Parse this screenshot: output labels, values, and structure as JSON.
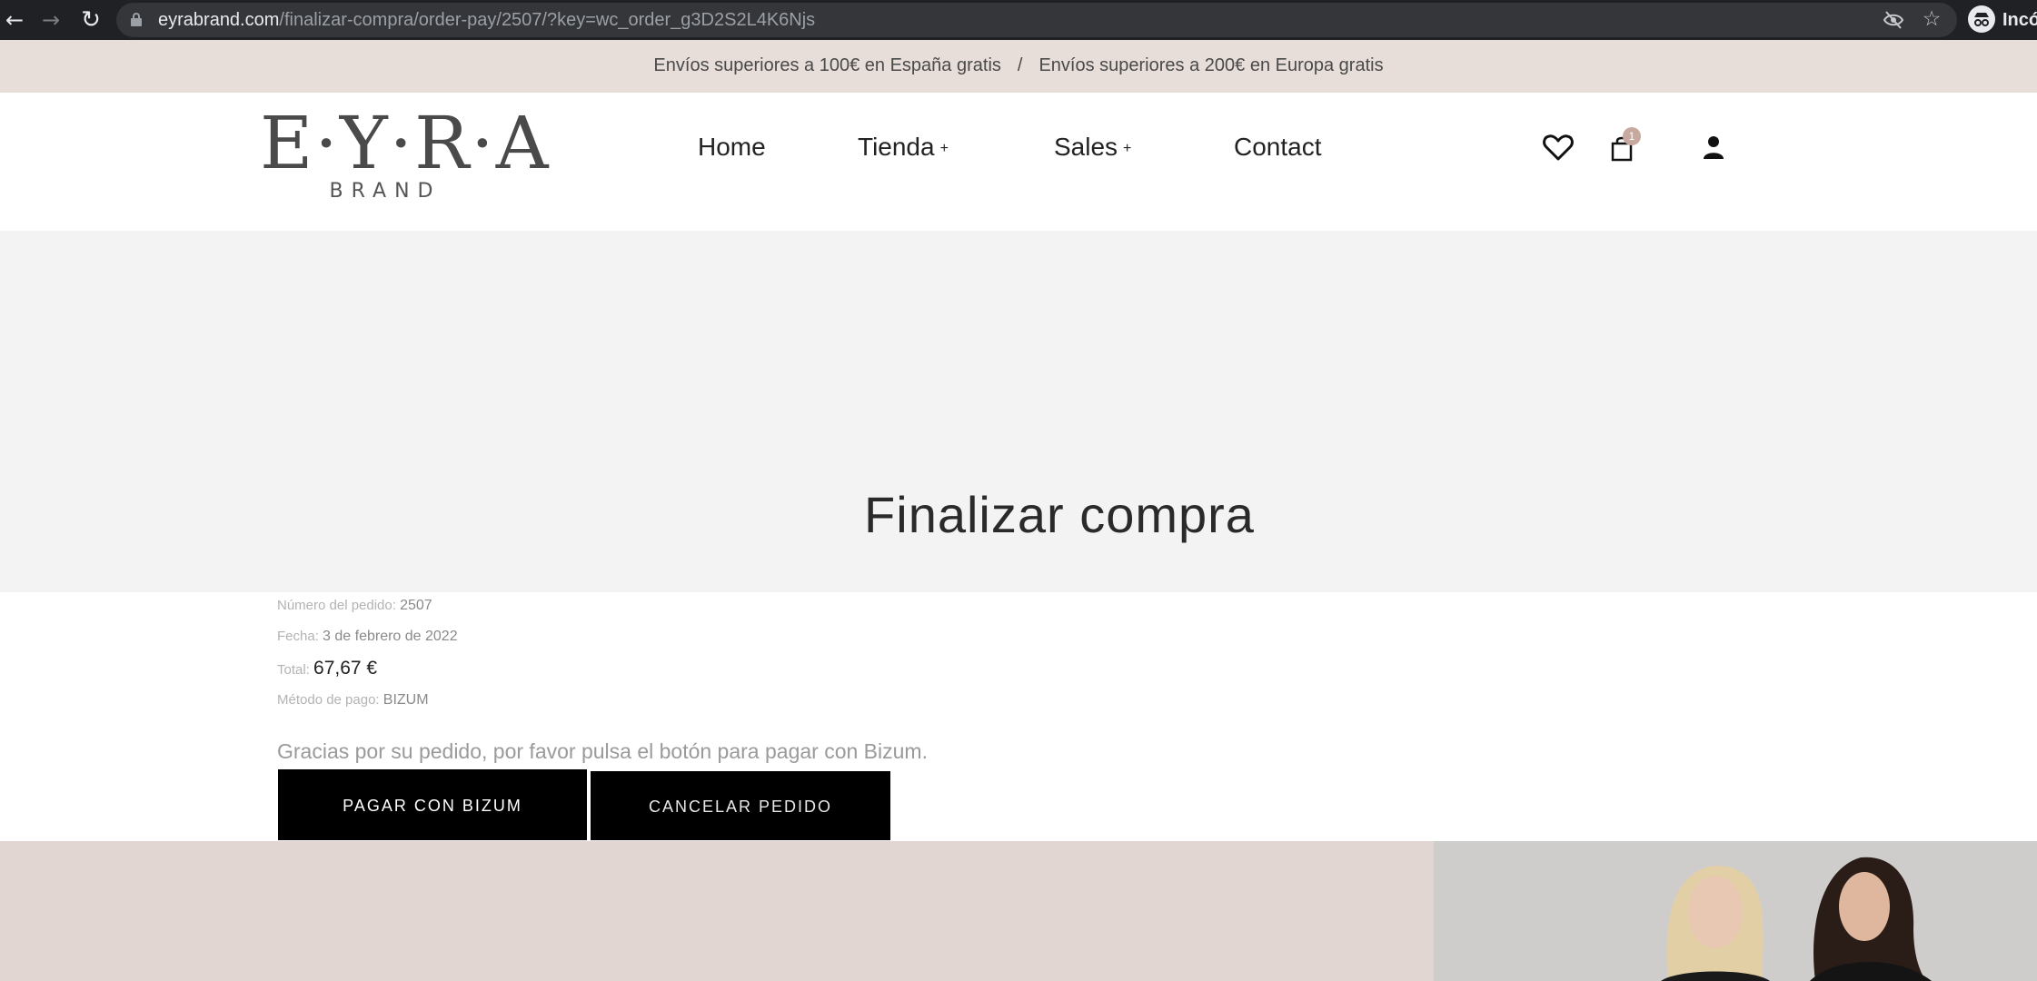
{
  "browser": {
    "url_domain": "eyrabrand.com",
    "url_path": "/finalizar-compra/order-pay/2507/?key=wc_order_g3D2S2L4K6Njs",
    "incognito_label": "Incóg",
    "icons": [
      "back-arrow-icon",
      "forward-arrow-icon",
      "reload-icon",
      "lock-icon",
      "eye-off-icon",
      "star-icon",
      "incognito-icon"
    ]
  },
  "announcement": {
    "spain": "Envíos superiores a 100€ en España gratis",
    "separator": "/",
    "europe": "Envíos superiores a 200€ en Europa gratis"
  },
  "header": {
    "logo_main": "E·Y·R·A",
    "logo_sub": "BRAND",
    "nav": {
      "home": "Home",
      "tienda": "Tienda",
      "sales": "Sales",
      "contact": "Contact",
      "plus": "+"
    },
    "cart_count": "1"
  },
  "hero": {
    "title": "Finalizar compra"
  },
  "order": {
    "number_label": "Número del pedido:",
    "number_value": "2507",
    "date_label": "Fecha:",
    "date_value": "3 de febrero de 2022",
    "total_label": "Total:",
    "total_value": "67,67 €",
    "method_label": "Método de pago:",
    "method_value": "BIZUM",
    "thanks": "Gracias por su pedido, por favor pulsa el botón para pagar con Bizum.",
    "pay_button": "PAGAR CON BIZUM",
    "cancel_button": "CANCELAR PEDIDO"
  },
  "colors": {
    "browser_bg": "#202124",
    "announcement_bg": "#e7ddd9",
    "hero_bg": "#f3f3f3",
    "button_bg": "#000000",
    "cart_badge": "#c8a9a0",
    "footer_bg": "#e2d6d3"
  }
}
